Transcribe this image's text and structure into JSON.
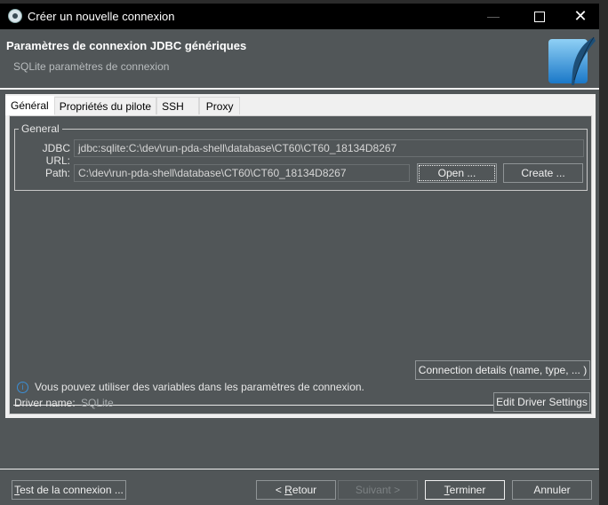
{
  "window": {
    "title": "Créer un nouvelle connexion",
    "minimize_label": "—",
    "close_label": "✕"
  },
  "header": {
    "title": "Paramètres de connexion JDBC génériques",
    "subtitle": "SQLite paramètres de connexion",
    "logo_icon": "sqlite-feather-logo"
  },
  "tabs": [
    {
      "label": "Général",
      "active": true
    },
    {
      "label": "Propriétés du pilote",
      "active": false
    },
    {
      "label": "SSH",
      "active": false
    },
    {
      "label": "Proxy",
      "active": false
    }
  ],
  "general_group": {
    "label": "General",
    "jdbc_url_label": "JDBC URL:",
    "jdbc_url_value": "jdbc:sqlite:C:\\dev\\run-pda-shell\\database\\CT60\\CT60_18134D8267",
    "path_label": "Path:",
    "path_value": "C:\\dev\\run-pda-shell\\database\\CT60\\CT60_18134D8267",
    "open_button": "Open ...",
    "create_button": "Create ..."
  },
  "info": {
    "icon": "info-icon",
    "text": "Vous pouvez utiliser des variables dans les paramètres de connexion.",
    "connection_details_button": "Connection details (name, type, ... )"
  },
  "driver": {
    "label": "Driver name:",
    "value": "SQLite",
    "edit_button": "Edit Driver Settings"
  },
  "footer": {
    "test_button_mnemonic": "T",
    "test_button_rest": "est de la connexion ...",
    "back_prefix": "< ",
    "back_mnemonic": "R",
    "back_rest": "etour",
    "next_button": "Suivant >",
    "finish_mnemonic": "T",
    "finish_rest": "erminer",
    "cancel_button": "Annuler"
  },
  "colors": {
    "dialog_bg": "#515658",
    "titlebar_bg": "#000000",
    "accent_info": "#3c8fd6"
  }
}
